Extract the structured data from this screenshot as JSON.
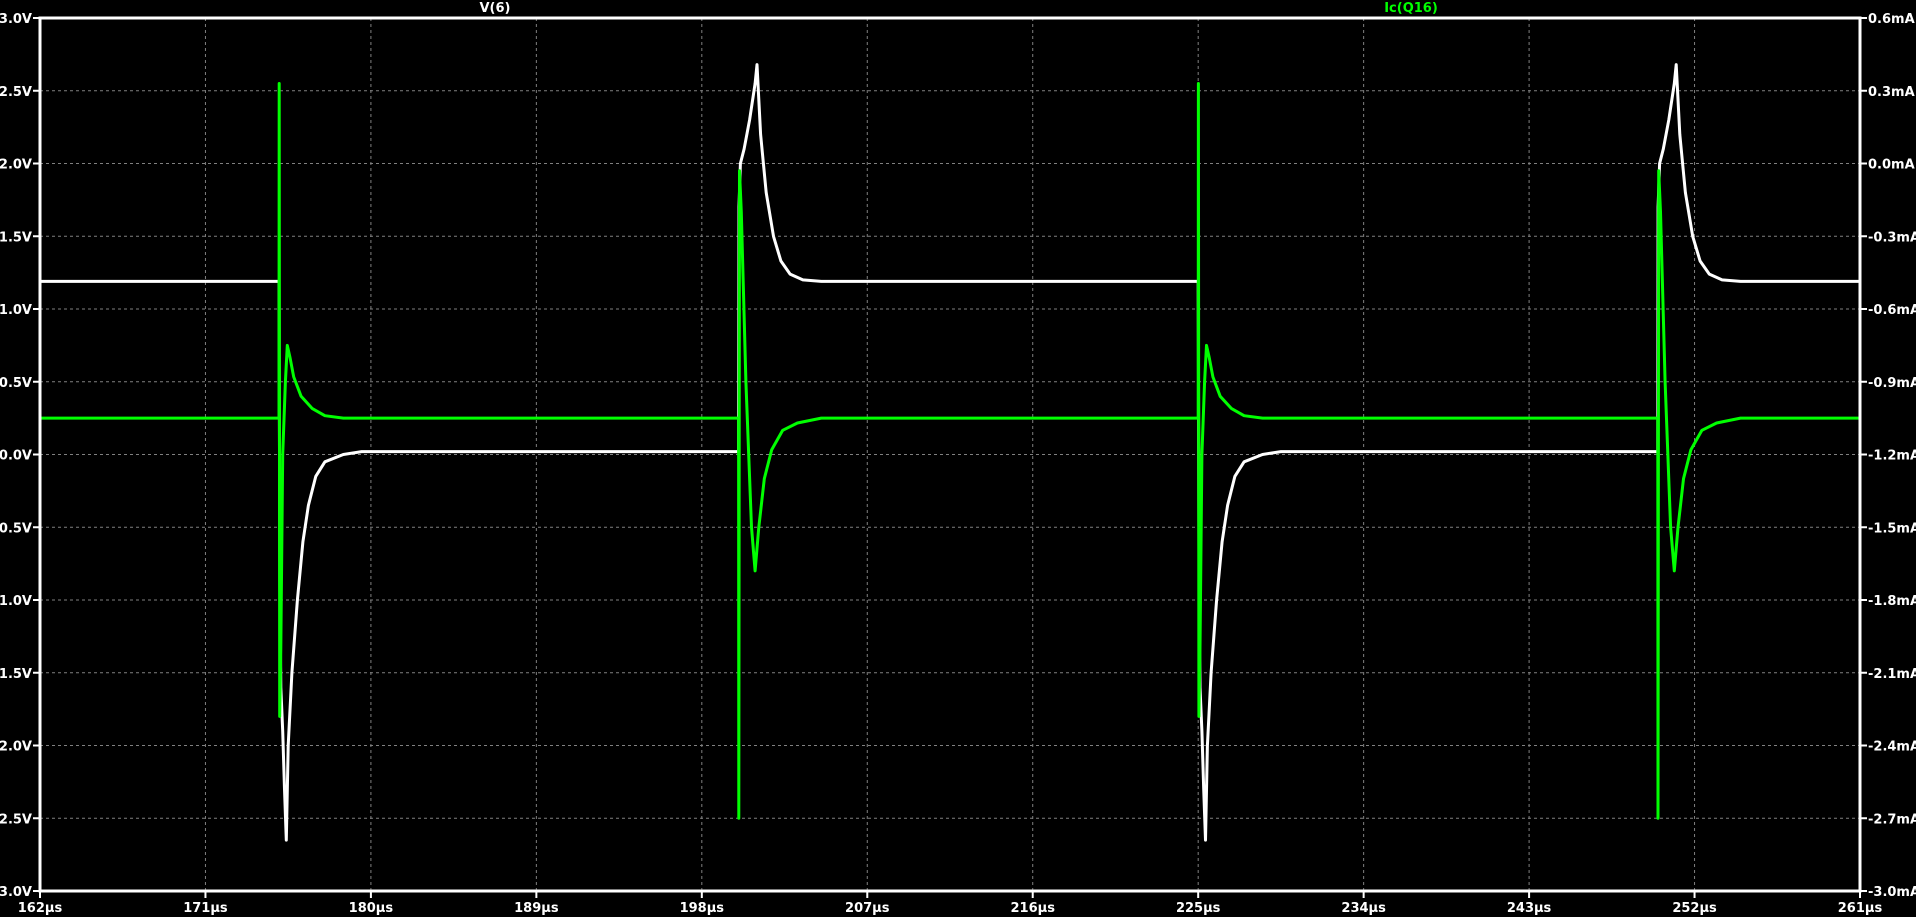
{
  "chart_data": {
    "type": "line",
    "title": "",
    "background_color": "#000000",
    "axis_color": "#ffffff",
    "grid": true,
    "grid_color": "#808080",
    "x_axis": {
      "range": [
        162,
        261
      ],
      "unit": "µs",
      "tick_labels": [
        "162µs",
        "171µs",
        "180µs",
        "189µs",
        "198µs",
        "207µs",
        "216µs",
        "225µs",
        "234µs",
        "243µs",
        "252µs",
        "261µs"
      ]
    },
    "y_left_axis": {
      "range": [
        -3.0,
        3.0
      ],
      "unit": "V",
      "tick_labels": [
        "3.0V",
        "2.5V",
        "2.0V",
        "1.5V",
        "1.0V",
        "0.5V",
        "0.0V",
        "-0.5V",
        "-1.0V",
        "-1.5V",
        "-2.0V",
        "-2.5V",
        "-3.0V"
      ]
    },
    "y_right_axis": {
      "range": [
        -3.0,
        0.6
      ],
      "unit": "mA",
      "tick_labels": [
        "0.6mA",
        "0.3mA",
        "0.0mA",
        "-0.3mA",
        "-0.6mA",
        "-0.9mA",
        "-1.2mA",
        "-1.5mA",
        "-1.8mA",
        "-2.1mA",
        "-2.4mA",
        "-2.7mA",
        "-3.0mA"
      ]
    },
    "series": [
      {
        "name": "V(6)",
        "axis": "left",
        "color": "#ffffff",
        "x": [
          162,
          175.0,
          175.05,
          175.1,
          175.2,
          175.3,
          175.4,
          175.5,
          175.7,
          176.0,
          176.3,
          176.6,
          177.0,
          177.5,
          178.5,
          179.5,
          200.0,
          200.02,
          200.1,
          200.3,
          200.6,
          200.9,
          201.0,
          201.2,
          201.5,
          201.9,
          202.3,
          202.8,
          203.5,
          204.5,
          225.0,
          225.05,
          225.1,
          225.2,
          225.3,
          225.4,
          225.5,
          225.7,
          226.0,
          226.3,
          226.6,
          227.0,
          227.5,
          228.5,
          229.5,
          250.0,
          250.02,
          250.1,
          250.3,
          250.6,
          250.9,
          251.0,
          251.2,
          251.5,
          251.9,
          252.3,
          252.8,
          253.5,
          254.5,
          261
        ],
        "y": [
          1.19,
          1.19,
          -0.9,
          -1.6,
          -1.9,
          -2.3,
          -2.65,
          -2.0,
          -1.5,
          -1.0,
          -0.6,
          -0.35,
          -0.15,
          -0.05,
          0.0,
          0.02,
          0.02,
          1.7,
          2.0,
          2.1,
          2.3,
          2.55,
          2.68,
          2.2,
          1.8,
          1.5,
          1.33,
          1.24,
          1.2,
          1.19,
          1.19,
          -0.9,
          -1.6,
          -1.9,
          -2.3,
          -2.65,
          -2.0,
          -1.5,
          -1.0,
          -0.6,
          -0.35,
          -0.15,
          -0.05,
          0.0,
          0.02,
          0.02,
          1.7,
          2.0,
          2.1,
          2.3,
          2.55,
          2.68,
          2.2,
          1.8,
          1.5,
          1.33,
          1.24,
          1.2,
          1.19,
          1.19
        ]
      },
      {
        "name": "Ic(Q16)",
        "axis": "right",
        "color": "#00ff00",
        "x": [
          162,
          175.0,
          175.01,
          175.04,
          175.1,
          175.2,
          175.35,
          175.45,
          175.6,
          175.8,
          176.2,
          176.8,
          177.5,
          178.5,
          200.0,
          200.01,
          200.05,
          200.15,
          200.4,
          200.7,
          200.9,
          201.1,
          201.4,
          201.8,
          202.4,
          203.2,
          204.5,
          225.0,
          225.01,
          225.04,
          225.1,
          225.2,
          225.35,
          225.45,
          225.6,
          225.8,
          226.2,
          226.8,
          227.5,
          228.5,
          250.0,
          250.01,
          250.05,
          250.15,
          250.4,
          250.7,
          250.9,
          251.1,
          251.4,
          251.8,
          252.4,
          253.2,
          254.5,
          261
        ],
        "y": [
          -1.05,
          -1.05,
          0.33,
          -2.28,
          -2.0,
          -1.2,
          -0.9,
          -0.75,
          -0.8,
          -0.88,
          -0.96,
          -1.01,
          -1.04,
          -1.05,
          -1.05,
          -2.7,
          -0.03,
          -0.2,
          -0.9,
          -1.5,
          -1.68,
          -1.5,
          -1.3,
          -1.18,
          -1.1,
          -1.07,
          -1.05,
          -1.05,
          0.33,
          -2.28,
          -2.0,
          -1.2,
          -0.9,
          -0.75,
          -0.8,
          -0.88,
          -0.96,
          -1.01,
          -1.04,
          -1.05,
          -1.05,
          -2.7,
          -0.03,
          -0.2,
          -0.9,
          -1.5,
          -1.68,
          -1.5,
          -1.3,
          -1.18,
          -1.1,
          -1.07,
          -1.05,
          -1.05
        ]
      }
    ]
  }
}
